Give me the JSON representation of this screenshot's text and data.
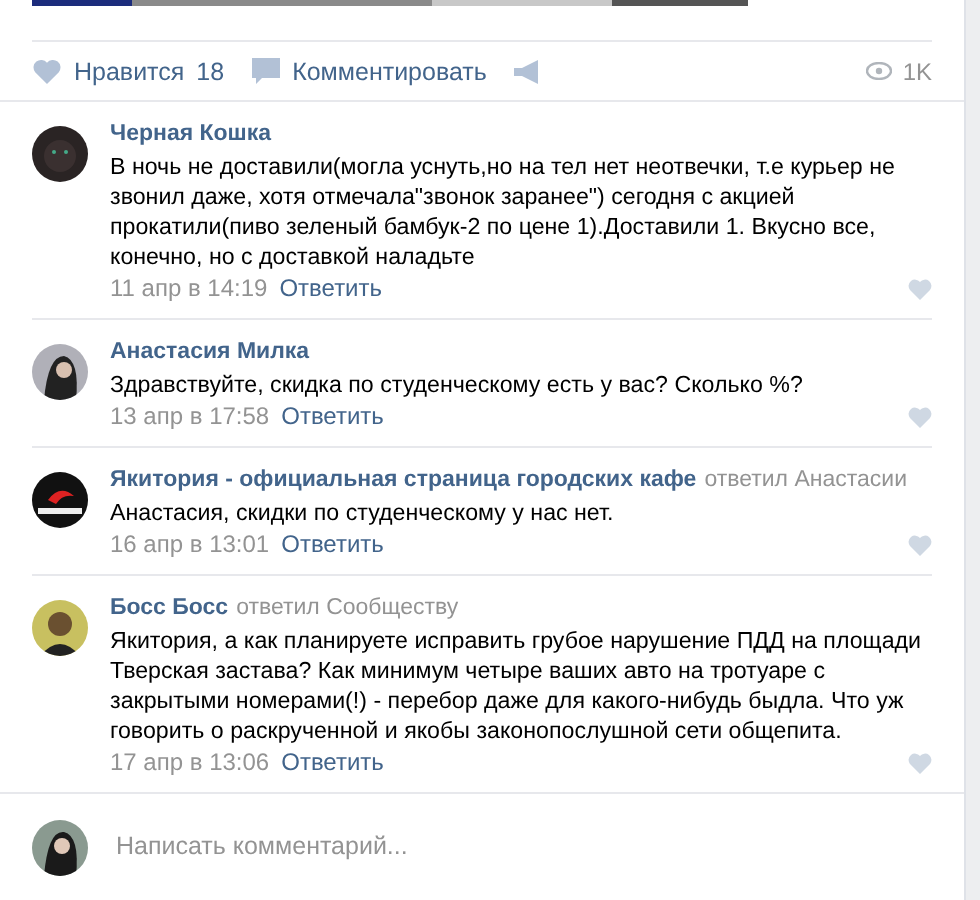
{
  "post_actions": {
    "like": {
      "label": "Нравится",
      "count": "18"
    },
    "comment": {
      "label": "Комментировать"
    },
    "views": "1K"
  },
  "comments": [
    {
      "author": "Черная Кошка",
      "text": "В ночь не доставили(могла уснуть,но на тел нет неотвечки, т.е курьер не звонил даже, хотя отмечала\"звонок заранее\") сегодня с акцией прокатили(пиво зеленый бамбук-2 по цене 1).Доставили 1. Вкусно все, конечно, но с доставкой наладьте",
      "date": "11 апр в 14:19",
      "reply_label": "Ответить"
    },
    {
      "author": "Анастасия Милка",
      "text": "Здравствуйте, скидка по студенческому есть у вас? Сколько %?",
      "date": "13 апр в 17:58",
      "reply_label": "Ответить"
    },
    {
      "author": "Якитория - официальная страница городских кафе",
      "reply_to": "ответил Анастасии",
      "text": "Анастасия, скидки по студенческому у нас нет.",
      "date": "16 апр в 13:01",
      "reply_label": "Ответить"
    },
    {
      "author": "Босс Босс",
      "reply_to": "ответил Сообществу",
      "text": "Якитория, а как планируете исправить грубое нарушение ПДД на площади Тверская застава? Как минимум четыре ваших авто на тротуаре с закрытыми номерами(!) - перебор даже для какого-нибудь быдла. Что уж говорить о раскрученной и якобы законопослушной сети общепита.",
      "date": "17 апр в 13:06",
      "reply_label": "Ответить"
    }
  ],
  "composer": {
    "placeholder": "Написать комментарий..."
  }
}
